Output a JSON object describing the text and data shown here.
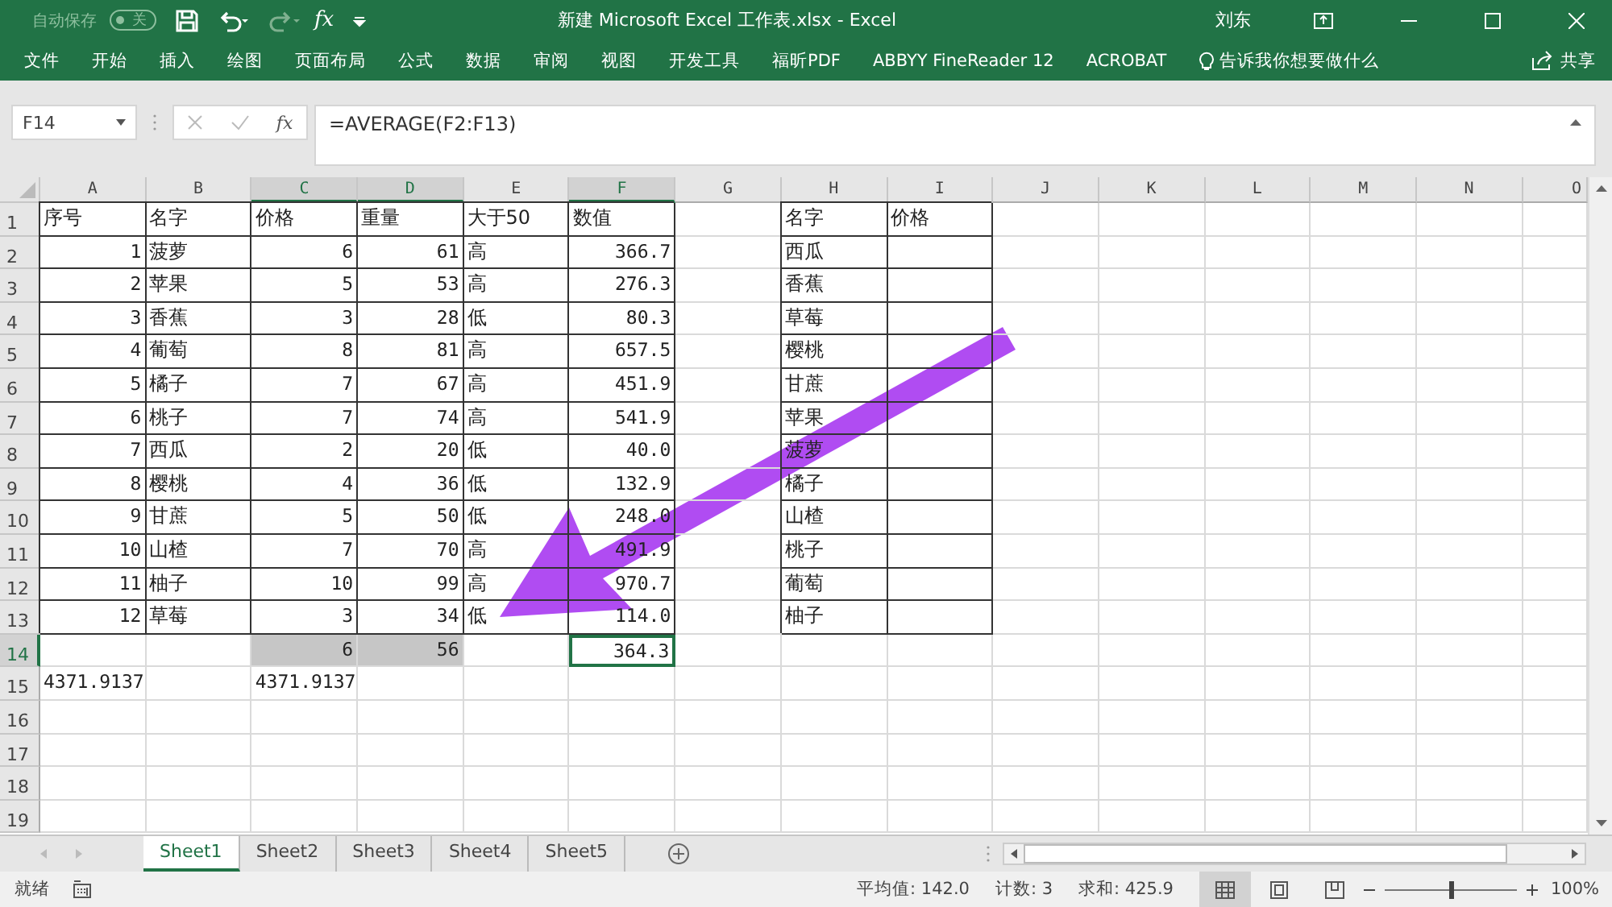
{
  "window": {
    "title": "新建 Microsoft Excel 工作表.xlsx  -  Excel",
    "user": "刘东"
  },
  "quick_access": {
    "autosave_label": "自动保存",
    "autosave_on": false,
    "autosave_state": "关",
    "fx": "fx"
  },
  "ribbon": {
    "tabs": [
      "文件",
      "开始",
      "插入",
      "绘图",
      "页面布局",
      "公式",
      "数据",
      "审阅",
      "视图",
      "开发工具",
      "福昕PDF",
      "ABBYY FineReader 12",
      "ACROBAT"
    ],
    "tell_me": "告诉我你想要做什么",
    "share": "共享"
  },
  "formula_bar": {
    "name_box": "F14",
    "fx": "fx",
    "formula": "=AVERAGE(F2:F13)"
  },
  "columns": [
    {
      "label": "A",
      "selected": false
    },
    {
      "label": "B",
      "selected": false
    },
    {
      "label": "C",
      "selected": true
    },
    {
      "label": "D",
      "selected": true
    },
    {
      "label": "E",
      "selected": false
    },
    {
      "label": "F",
      "selected": true
    },
    {
      "label": "G",
      "selected": false
    },
    {
      "label": "H",
      "selected": false
    },
    {
      "label": "I",
      "selected": false
    },
    {
      "label": "J",
      "selected": false
    },
    {
      "label": "K",
      "selected": false
    },
    {
      "label": "L",
      "selected": false
    },
    {
      "label": "M",
      "selected": false
    },
    {
      "label": "N",
      "selected": false
    },
    {
      "label": "O",
      "selected": false
    }
  ],
  "rows": [
    {
      "number": "1",
      "selected": false,
      "cells": [
        {
          "text": "序号",
          "kind": "text",
          "boxed": true
        },
        {
          "text": "名字",
          "kind": "text",
          "boxed": true
        },
        {
          "text": "价格",
          "kind": "text",
          "boxed": true
        },
        {
          "text": "重量",
          "kind": "text",
          "boxed": true
        },
        {
          "text": "大于50",
          "kind": "text",
          "boxed": true
        },
        {
          "text": "数值",
          "kind": "text",
          "boxed": true
        },
        null,
        {
          "text": "名字",
          "kind": "text",
          "boxed": true
        },
        {
          "text": "价格",
          "kind": "text",
          "boxed": true
        }
      ]
    },
    {
      "number": "2",
      "selected": false,
      "cells": [
        {
          "text": "1",
          "kind": "number",
          "boxed": true
        },
        {
          "text": "菠萝",
          "kind": "text",
          "boxed": true
        },
        {
          "text": "6",
          "kind": "number",
          "boxed": true
        },
        {
          "text": "61",
          "kind": "number",
          "boxed": true
        },
        {
          "text": "高",
          "kind": "text",
          "boxed": true
        },
        {
          "text": "366.7",
          "kind": "number",
          "boxed": true
        },
        null,
        {
          "text": "西瓜",
          "kind": "text",
          "boxed": true
        },
        {
          "kind": "text",
          "boxed": true
        }
      ]
    },
    {
      "number": "3",
      "selected": false,
      "cells": [
        {
          "text": "2",
          "kind": "number",
          "boxed": true
        },
        {
          "text": "苹果",
          "kind": "text",
          "boxed": true
        },
        {
          "text": "5",
          "kind": "number",
          "boxed": true
        },
        {
          "text": "53",
          "kind": "number",
          "boxed": true
        },
        {
          "text": "高",
          "kind": "text",
          "boxed": true
        },
        {
          "text": "276.3",
          "kind": "number",
          "boxed": true
        },
        null,
        {
          "text": "香蕉",
          "kind": "text",
          "boxed": true
        },
        {
          "kind": "text",
          "boxed": true
        }
      ]
    },
    {
      "number": "4",
      "selected": false,
      "cells": [
        {
          "text": "3",
          "kind": "number",
          "boxed": true
        },
        {
          "text": "香蕉",
          "kind": "text",
          "boxed": true
        },
        {
          "text": "3",
          "kind": "number",
          "boxed": true
        },
        {
          "text": "28",
          "kind": "number",
          "boxed": true
        },
        {
          "text": "低",
          "kind": "text",
          "boxed": true
        },
        {
          "text": "80.3",
          "kind": "number",
          "boxed": true
        },
        null,
        {
          "text": "草莓",
          "kind": "text",
          "boxed": true
        },
        {
          "kind": "text",
          "boxed": true
        }
      ]
    },
    {
      "number": "5",
      "selected": false,
      "cells": [
        {
          "text": "4",
          "kind": "number",
          "boxed": true
        },
        {
          "text": "葡萄",
          "kind": "text",
          "boxed": true
        },
        {
          "text": "8",
          "kind": "number",
          "boxed": true
        },
        {
          "text": "81",
          "kind": "number",
          "boxed": true
        },
        {
          "text": "高",
          "kind": "text",
          "boxed": true
        },
        {
          "text": "657.5",
          "kind": "number",
          "boxed": true
        },
        null,
        {
          "text": "樱桃",
          "kind": "text",
          "boxed": true
        },
        {
          "kind": "text",
          "boxed": true
        }
      ]
    },
    {
      "number": "6",
      "selected": false,
      "cells": [
        {
          "text": "5",
          "kind": "number",
          "boxed": true
        },
        {
          "text": "橘子",
          "kind": "text",
          "boxed": true
        },
        {
          "text": "7",
          "kind": "number",
          "boxed": true
        },
        {
          "text": "67",
          "kind": "number",
          "boxed": true
        },
        {
          "text": "高",
          "kind": "text",
          "boxed": true
        },
        {
          "text": "451.9",
          "kind": "number",
          "boxed": true
        },
        null,
        {
          "text": "甘蔗",
          "kind": "text",
          "boxed": true
        },
        {
          "kind": "text",
          "boxed": true
        }
      ]
    },
    {
      "number": "7",
      "selected": false,
      "cells": [
        {
          "text": "6",
          "kind": "number",
          "boxed": true
        },
        {
          "text": "桃子",
          "kind": "text",
          "boxed": true
        },
        {
          "text": "7",
          "kind": "number",
          "boxed": true
        },
        {
          "text": "74",
          "kind": "number",
          "boxed": true
        },
        {
          "text": "高",
          "kind": "text",
          "boxed": true
        },
        {
          "text": "541.9",
          "kind": "number",
          "boxed": true
        },
        null,
        {
          "text": "苹果",
          "kind": "text",
          "boxed": true
        },
        {
          "kind": "text",
          "boxed": true
        }
      ]
    },
    {
      "number": "8",
      "selected": false,
      "cells": [
        {
          "text": "7",
          "kind": "number",
          "boxed": true
        },
        {
          "text": "西瓜",
          "kind": "text",
          "boxed": true
        },
        {
          "text": "2",
          "kind": "number",
          "boxed": true
        },
        {
          "text": "20",
          "kind": "number",
          "boxed": true
        },
        {
          "text": "低",
          "kind": "text",
          "boxed": true
        },
        {
          "text": "40.0",
          "kind": "number",
          "boxed": true
        },
        null,
        {
          "text": "菠萝",
          "kind": "text",
          "boxed": true
        },
        {
          "kind": "text",
          "boxed": true
        }
      ]
    },
    {
      "number": "9",
      "selected": false,
      "cells": [
        {
          "text": "8",
          "kind": "number",
          "boxed": true
        },
        {
          "text": "樱桃",
          "kind": "text",
          "boxed": true
        },
        {
          "text": "4",
          "kind": "number",
          "boxed": true
        },
        {
          "text": "36",
          "kind": "number",
          "boxed": true
        },
        {
          "text": "低",
          "kind": "text",
          "boxed": true
        },
        {
          "text": "132.9",
          "kind": "number",
          "boxed": true
        },
        null,
        {
          "text": "橘子",
          "kind": "text",
          "boxed": true
        },
        {
          "kind": "text",
          "boxed": true
        }
      ]
    },
    {
      "number": "10",
      "selected": false,
      "cells": [
        {
          "text": "9",
          "kind": "number",
          "boxed": true
        },
        {
          "text": "甘蔗",
          "kind": "text",
          "boxed": true
        },
        {
          "text": "5",
          "kind": "number",
          "boxed": true
        },
        {
          "text": "50",
          "kind": "number",
          "boxed": true
        },
        {
          "text": "低",
          "kind": "text",
          "boxed": true
        },
        {
          "text": "248.0",
          "kind": "number",
          "boxed": true
        },
        null,
        {
          "text": "山楂",
          "kind": "text",
          "boxed": true
        },
        {
          "kind": "text",
          "boxed": true
        }
      ]
    },
    {
      "number": "11",
      "selected": false,
      "cells": [
        {
          "text": "10",
          "kind": "number",
          "boxed": true
        },
        {
          "text": "山楂",
          "kind": "text",
          "boxed": true
        },
        {
          "text": "7",
          "kind": "number",
          "boxed": true
        },
        {
          "text": "70",
          "kind": "number",
          "boxed": true
        },
        {
          "text": "高",
          "kind": "text",
          "boxed": true
        },
        {
          "text": "491.9",
          "kind": "number",
          "boxed": true
        },
        null,
        {
          "text": "桃子",
          "kind": "text",
          "boxed": true
        },
        {
          "kind": "text",
          "boxed": true
        }
      ]
    },
    {
      "number": "12",
      "selected": false,
      "cells": [
        {
          "text": "11",
          "kind": "number",
          "boxed": true
        },
        {
          "text": "柚子",
          "kind": "text",
          "boxed": true
        },
        {
          "text": "10",
          "kind": "number",
          "boxed": true
        },
        {
          "text": "99",
          "kind": "number",
          "boxed": true
        },
        {
          "text": "高",
          "kind": "text",
          "boxed": true
        },
        {
          "text": "970.7",
          "kind": "number",
          "boxed": true
        },
        null,
        {
          "text": "葡萄",
          "kind": "text",
          "boxed": true
        },
        {
          "kind": "text",
          "boxed": true
        }
      ]
    },
    {
      "number": "13",
      "selected": false,
      "cells": [
        {
          "text": "12",
          "kind": "number",
          "boxed": true
        },
        {
          "text": "草莓",
          "kind": "text",
          "boxed": true
        },
        {
          "text": "3",
          "kind": "number",
          "boxed": true
        },
        {
          "text": "34",
          "kind": "number",
          "boxed": true
        },
        {
          "text": "低",
          "kind": "text",
          "boxed": true
        },
        {
          "text": "114.0",
          "kind": "number",
          "boxed": true
        },
        null,
        {
          "text": "柚子",
          "kind": "text",
          "boxed": true
        },
        {
          "kind": "text",
          "boxed": true
        }
      ]
    },
    {
      "number": "14",
      "selected": true,
      "cells": [
        null,
        null,
        {
          "text": "6",
          "kind": "number",
          "selected": true
        },
        {
          "text": "56",
          "kind": "number",
          "selected": true
        },
        null,
        {
          "text": "364.3",
          "kind": "number",
          "active": true
        }
      ]
    },
    {
      "number": "15",
      "selected": false,
      "cells": [
        {
          "text": "4371.9137",
          "kind": "number"
        },
        null,
        {
          "text": "4371.9137",
          "kind": "number"
        }
      ]
    },
    {
      "number": "16",
      "selected": false,
      "cells": []
    },
    {
      "number": "17",
      "selected": false,
      "cells": []
    },
    {
      "number": "18",
      "selected": false,
      "cells": []
    },
    {
      "number": "19",
      "selected": false,
      "cells": []
    }
  ],
  "sheet_tabs": [
    {
      "label": "Sheet1",
      "selected": true
    },
    {
      "label": "Sheet2",
      "selected": false
    },
    {
      "label": "Sheet3",
      "selected": false
    },
    {
      "label": "Sheet4",
      "selected": false
    },
    {
      "label": "Sheet5",
      "selected": false
    }
  ],
  "status_bar": {
    "state": "就绪",
    "average": "平均值: 142.0",
    "count": "计数: 3",
    "sum": "求和: 425.9",
    "zoom": {
      "level": 0.5
    },
    "zoom_label": "100%"
  }
}
